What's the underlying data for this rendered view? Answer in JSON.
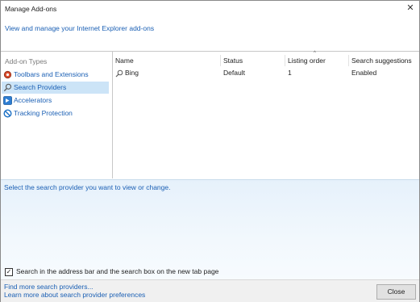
{
  "window": {
    "title": "Manage Add-ons"
  },
  "header": {
    "link": "View and manage your Internet Explorer add-ons"
  },
  "sidebar": {
    "heading": "Add-on Types",
    "items": [
      {
        "label": "Toolbars and Extensions",
        "icon": "gear-icon"
      },
      {
        "label": "Search Providers",
        "icon": "search-icon",
        "selected": true
      },
      {
        "label": "Accelerators",
        "icon": "accelerator-icon"
      },
      {
        "label": "Tracking Protection",
        "icon": "block-icon"
      }
    ]
  },
  "list": {
    "columns": [
      "Name",
      "Status",
      "Listing order",
      "Search suggestions"
    ],
    "rows": [
      {
        "name": "Bing",
        "status": "Default",
        "order": "1",
        "suggestions": "Enabled"
      }
    ]
  },
  "details": {
    "message": "Select the search provider you want to view or change.",
    "checkbox_label": "Search in the address bar and the search box on the new tab page",
    "checkbox_checked": true
  },
  "footer": {
    "link1": "Find more search providers...",
    "link2": "Learn more about search provider preferences",
    "close_label": "Close"
  },
  "colors": {
    "link": "#1a5fb4",
    "selection": "#cce4f7"
  }
}
